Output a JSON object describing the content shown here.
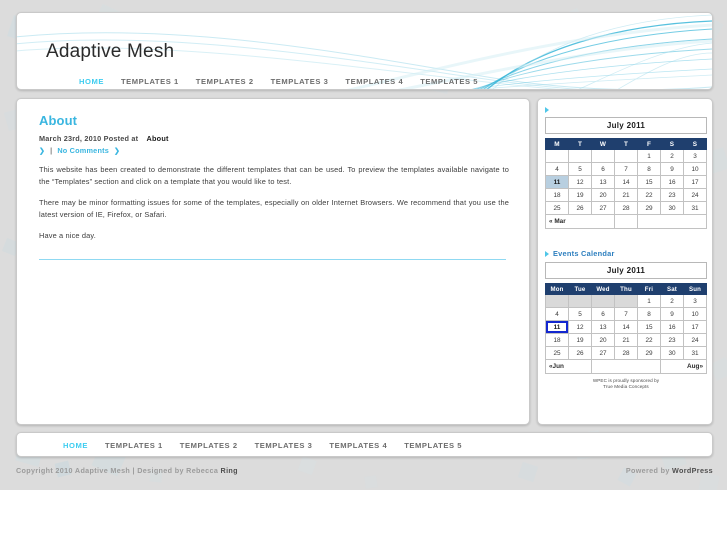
{
  "site": {
    "title": "Adaptive Mesh"
  },
  "nav": {
    "items": [
      {
        "label": "HOME",
        "active": true
      },
      {
        "label": "TEMPLATES 1",
        "active": false
      },
      {
        "label": "TEMPLATES 2",
        "active": false
      },
      {
        "label": "TEMPLATES 3",
        "active": false
      },
      {
        "label": "TEMPLATES 4",
        "active": false
      },
      {
        "label": "TEMPLATES 5",
        "active": false
      }
    ]
  },
  "post": {
    "title": "About",
    "date": "March 23rd, 2010",
    "posted_at_label": "Posted at",
    "category": "About",
    "comments_label": "No Comments",
    "separator": "|",
    "paragraphs": [
      "This website has been created to demonstrate the different templates that can be used. To preview the templates available navigate to the “Templates” section and click on a template that you would like to test.",
      "There may be minor formatting issues for some of the templates, especially on older Internet Browsers. We recommend that you use the latest version of IE, Firefox, or Safari.",
      "Have a nice day."
    ]
  },
  "sidebar": {
    "calendar_widget": {
      "title": "",
      "caption": "July 2011",
      "weekdays": [
        "M",
        "T",
        "W",
        "T",
        "F",
        "S",
        "S"
      ],
      "weeks": [
        [
          "",
          "",
          "",
          "",
          "1",
          "2",
          "3"
        ],
        [
          "4",
          "5",
          "6",
          "7",
          "8",
          "9",
          "10"
        ],
        [
          "11",
          "12",
          "13",
          "14",
          "15",
          "16",
          "17"
        ],
        [
          "18",
          "19",
          "20",
          "21",
          "22",
          "23",
          "24"
        ],
        [
          "25",
          "26",
          "27",
          "28",
          "29",
          "30",
          "31"
        ]
      ],
      "today": "11",
      "prev_label": "« Mar",
      "next_label": ""
    },
    "events_widget": {
      "title": "Events Calendar",
      "caption": "July  2011",
      "weekdays": [
        "Mon",
        "Tue",
        "Wed",
        "Thu",
        "Fri",
        "Sat",
        "Sun"
      ],
      "weeks": [
        [
          "",
          "",
          "",
          "",
          "1",
          "2",
          "3"
        ],
        [
          "4",
          "5",
          "6",
          "7",
          "8",
          "9",
          "10"
        ],
        [
          "11",
          "12",
          "13",
          "14",
          "15",
          "16",
          "17"
        ],
        [
          "18",
          "19",
          "20",
          "21",
          "22",
          "23",
          "24"
        ],
        [
          "25",
          "26",
          "27",
          "28",
          "29",
          "30",
          "31"
        ]
      ],
      "today": "11",
      "prev_label": "«Jun",
      "next_label": "Aug»",
      "sponsor_line1": "WPEC is proudly sponsored by",
      "sponsor_line2": "True Media Concepts"
    }
  },
  "footer": {
    "copyright_prefix": "Copyright 2010 Adaptive Mesh | Designed by Rebecca ",
    "copyright_strong": "Ring",
    "powered_prefix": "Powered by ",
    "powered_strong": "WordPress"
  },
  "colors": {
    "accent_cyan": "#3ecdf0",
    "link_blue": "#3ab6e0",
    "calendar_header": "#1f3f6e",
    "today_highlight": "#b8cfe0",
    "today_outline": "#1327cf",
    "page_bg": "#dcdcdc"
  }
}
